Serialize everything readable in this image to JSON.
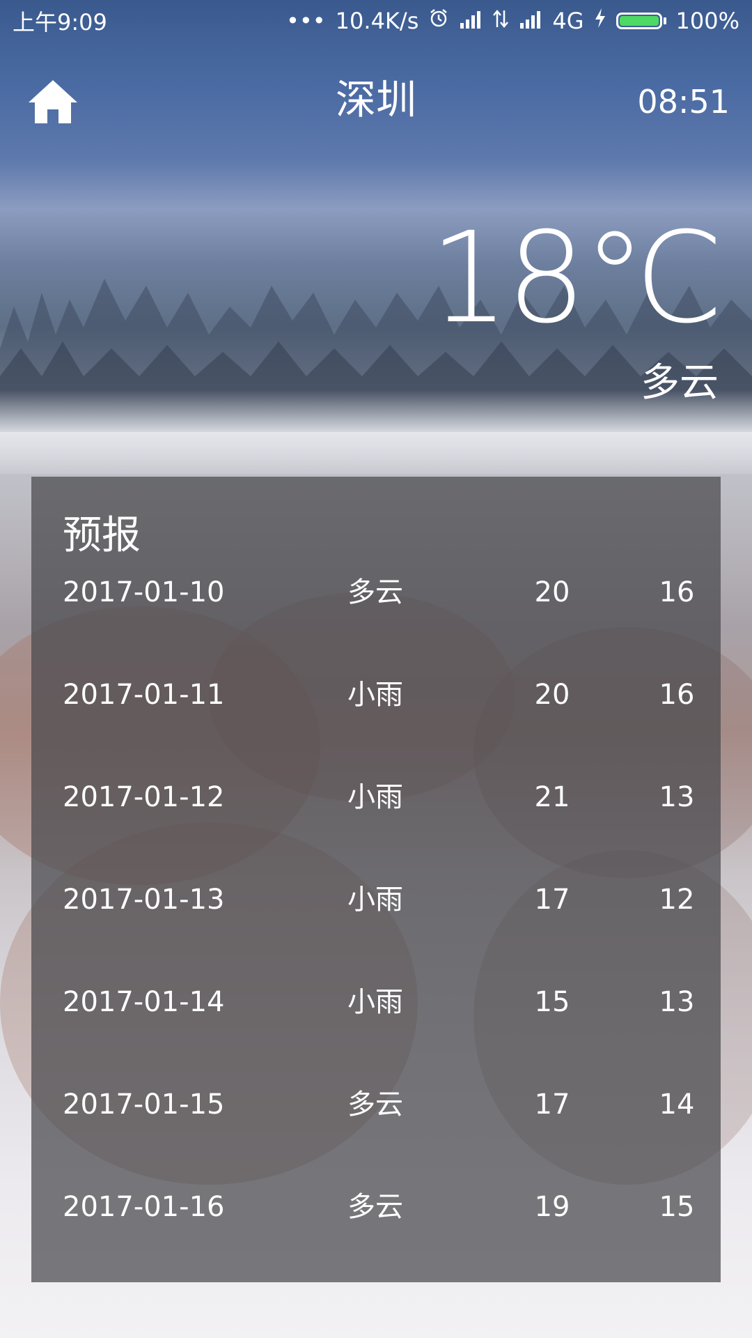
{
  "status_bar": {
    "time": "上午9:09",
    "dots": "•••",
    "net_speed": "10.4K/s",
    "network_type": "4G",
    "battery_percent": "100%",
    "battery_level": 1.0,
    "icons": [
      "alarm-icon",
      "signal-icon",
      "data-arrows-icon",
      "signal-icon",
      "charging-icon",
      "battery-icon"
    ]
  },
  "header": {
    "home_icon": "home-icon",
    "city": "深圳",
    "update_time": "08:51"
  },
  "current": {
    "temperature": "18℃",
    "condition": "多云"
  },
  "forecast": {
    "title": "预报",
    "days": [
      {
        "date": "2017-01-10",
        "condition": "多云",
        "max": "20",
        "min": "16"
      },
      {
        "date": "2017-01-11",
        "condition": "小雨",
        "max": "20",
        "min": "16"
      },
      {
        "date": "2017-01-12",
        "condition": "小雨",
        "max": "21",
        "min": "13"
      },
      {
        "date": "2017-01-13",
        "condition": "小雨",
        "max": "17",
        "min": "12"
      },
      {
        "date": "2017-01-14",
        "condition": "小雨",
        "max": "15",
        "min": "13"
      },
      {
        "date": "2017-01-15",
        "condition": "多云",
        "max": "17",
        "min": "14"
      },
      {
        "date": "2017-01-16",
        "condition": "多云",
        "max": "19",
        "min": "15"
      }
    ]
  },
  "colors": {
    "text": "#ffffff",
    "panel": "#48484c",
    "battery_fill": "#4cd964"
  }
}
